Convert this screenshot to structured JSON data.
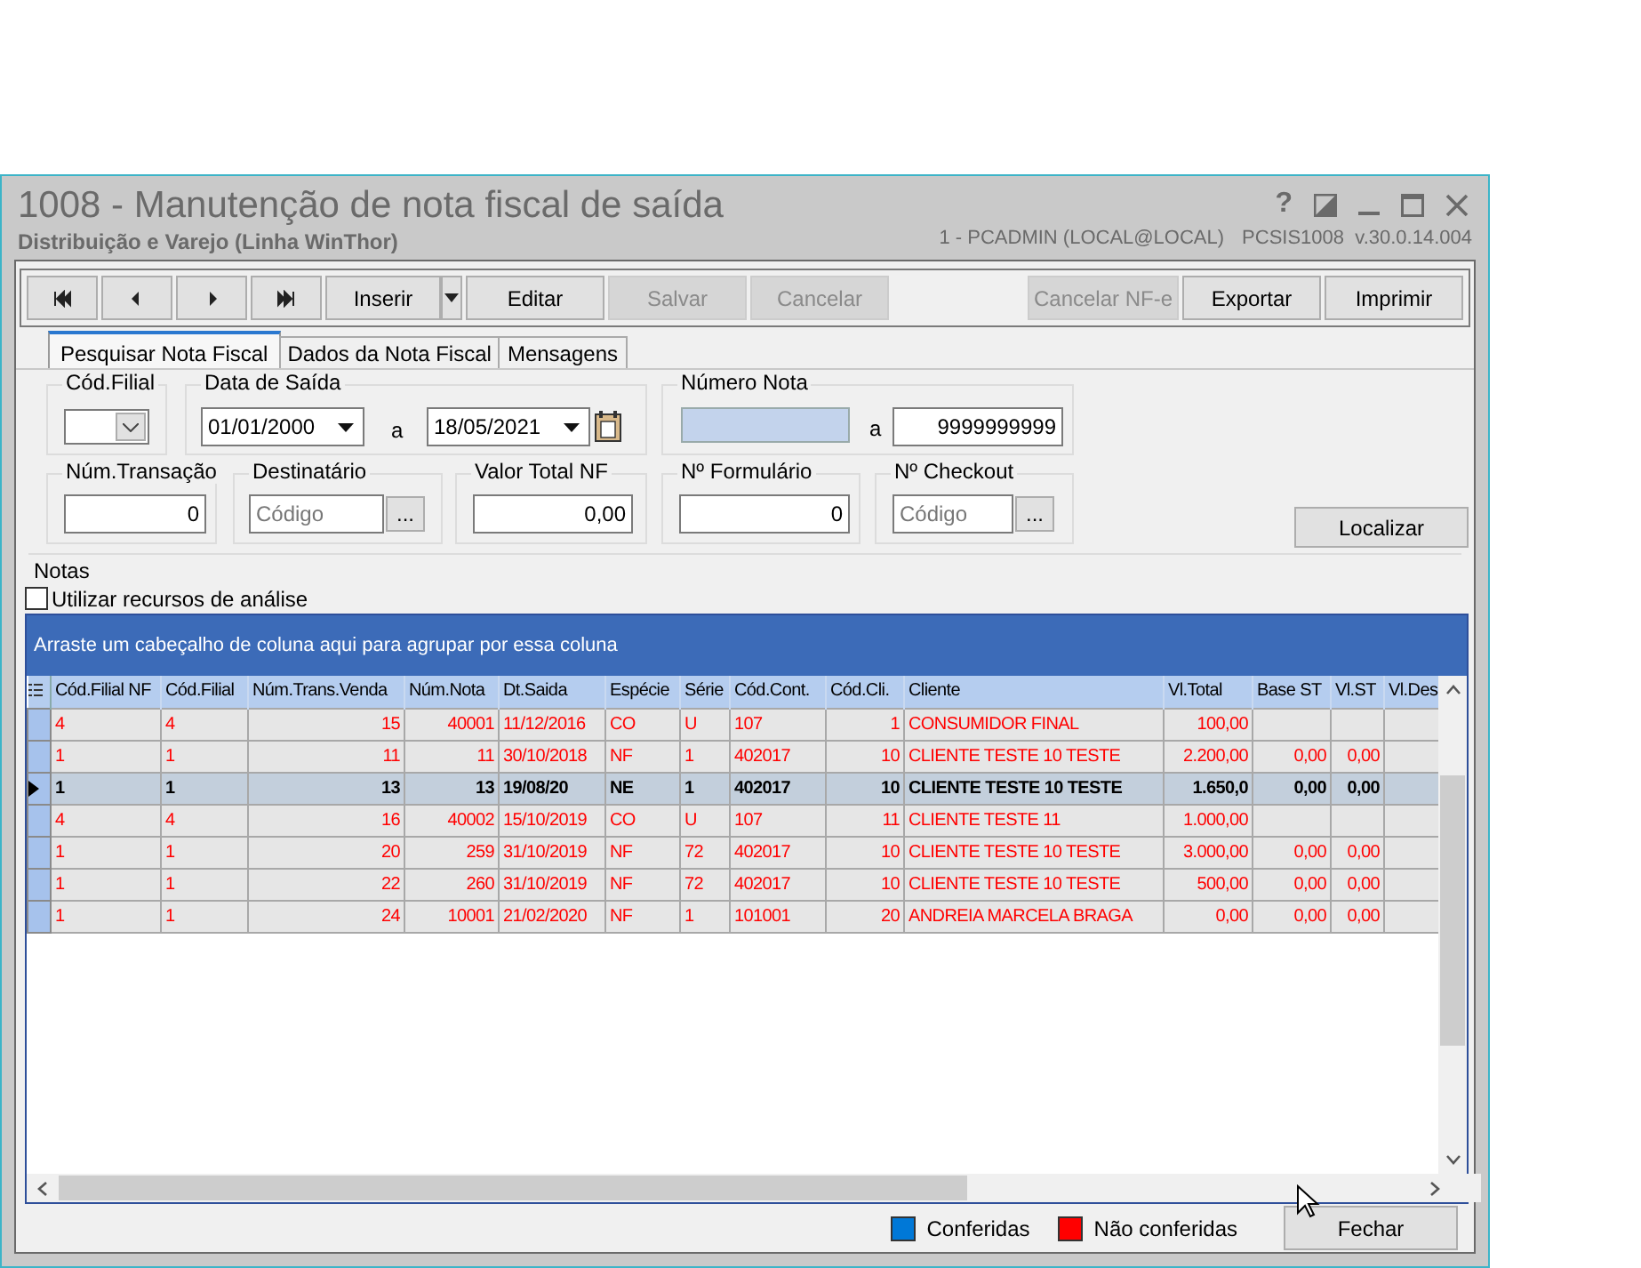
{
  "window": {
    "title": "1008 - Manutenção de nota fiscal de saída",
    "subtitle": "Distribuição e Varejo (Linha WinThor)",
    "user_info": "1 - PCADMIN (LOCAL@LOCAL)",
    "version": "PCSIS1008  v.30.0.14.004",
    "help": "?"
  },
  "toolbar": [
    {
      "kind": "first",
      "disabled": false
    },
    {
      "kind": "prev",
      "disabled": false
    },
    {
      "kind": "next",
      "disabled": false
    },
    {
      "kind": "last",
      "disabled": false
    },
    {
      "kind": "text",
      "label": "Inserir",
      "disabled": false
    },
    {
      "kind": "menu",
      "disabled": false
    },
    {
      "kind": "text",
      "label": "Editar",
      "disabled": false
    },
    {
      "kind": "text",
      "label": "Salvar",
      "disabled": true
    },
    {
      "kind": "text",
      "label": "Cancelar",
      "disabled": true
    },
    {
      "kind": "spacer"
    },
    {
      "kind": "text",
      "label": "Cancelar NF-e",
      "disabled": true
    },
    {
      "kind": "text",
      "label": "Exportar",
      "disabled": false
    },
    {
      "kind": "text",
      "label": "Imprimir",
      "disabled": false
    }
  ],
  "tabs": [
    {
      "label": "Pesquisar Nota Fiscal",
      "selected": true
    },
    {
      "label": "Dados da Nota Fiscal",
      "selected": false
    },
    {
      "label": "Mensagens",
      "selected": false
    }
  ],
  "filters": {
    "cod_filial": {
      "label": "Cód.Filial"
    },
    "data_saida": {
      "label": "Data de Saída",
      "from": "01/01/2000",
      "separator": "a",
      "to": "18/05/2021"
    },
    "numero_nota": {
      "label": "Número Nota",
      "separator": "a",
      "to": "9999999999"
    },
    "num_transacao": {
      "label": "Núm.Transação",
      "value": "0"
    },
    "destinatario": {
      "label": "Destinatário",
      "placeholder": "Código",
      "button": "..."
    },
    "valor_total": {
      "label": "Valor Total NF",
      "value": "0,00"
    },
    "num_formulario": {
      "label": "Nº Formulário",
      "value": "0"
    },
    "num_checkout": {
      "label": "Nº Checkout",
      "placeholder": "Código",
      "button": "..."
    },
    "search_button": "Localizar"
  },
  "notas": {
    "label": "Notas",
    "analysis_checkbox": {
      "label": "Utilizar recursos de análise",
      "checked": false
    },
    "group_hint": "Arraste um cabeçalho de coluna aqui para agrupar por essa coluna",
    "columns": [
      "Cód.Filial NF",
      "Cód.Filial",
      "Núm.Trans.Venda",
      "Núm.Nota",
      "Dt.Saida",
      "Espécie",
      "Série",
      "Cód.Cont.",
      "Cód.Cli.",
      "Cliente",
      "Vl.Total",
      "Base ST",
      "Vl.ST",
      "Vl.Des"
    ],
    "rows": [
      {
        "selected": false,
        "conferida": false,
        "cells": [
          "4",
          "4",
          "15",
          "40001",
          "11/12/2016",
          "CO",
          "U",
          "107",
          "1",
          "CONSUMIDOR FINAL",
          "100,00",
          null,
          null,
          null
        ]
      },
      {
        "selected": false,
        "conferida": false,
        "cells": [
          "1",
          "1",
          "11",
          "11",
          "30/10/2018",
          "NF",
          "1",
          "402017",
          "10",
          "CLIENTE TESTE 10 TESTE",
          "2.200,00",
          "0,00",
          "0,00",
          null
        ]
      },
      {
        "selected": true,
        "conferida": false,
        "cells": [
          "1",
          "1",
          "13",
          "13",
          "19/08/20",
          "NE",
          "1",
          "402017",
          "10",
          "CLIENTE TESTE 10 TESTE",
          "1.650,0",
          "0,00",
          "0,00",
          null
        ]
      },
      {
        "selected": false,
        "conferida": false,
        "cells": [
          "4",
          "4",
          "16",
          "40002",
          "15/10/2019",
          "CO",
          "U",
          "107",
          "11",
          "CLIENTE TESTE 11",
          "1.000,00",
          null,
          null,
          null
        ]
      },
      {
        "selected": false,
        "conferida": false,
        "cells": [
          "1",
          "1",
          "20",
          "259",
          "31/10/2019",
          "NF",
          "72",
          "402017",
          "10",
          "CLIENTE TESTE 10 TESTE",
          "3.000,00",
          "0,00",
          "0,00",
          null
        ]
      },
      {
        "selected": false,
        "conferida": false,
        "cells": [
          "1",
          "1",
          "22",
          "260",
          "31/10/2019",
          "NF",
          "72",
          "402017",
          "10",
          "CLIENTE TESTE 10 TESTE",
          "500,00",
          "0,00",
          "0,00",
          null
        ]
      },
      {
        "selected": false,
        "conferida": false,
        "cells": [
          "1",
          "1",
          "24",
          "10001",
          "21/02/2020",
          "NF",
          "1",
          "101001",
          "20",
          "ANDREIA MARCELA BRAGA",
          "0,00",
          "0,00",
          "0,00",
          null
        ]
      }
    ]
  },
  "legend": [
    {
      "label": "Conferidas",
      "color": "#0078d7"
    },
    {
      "label": "Não conferidas",
      "color": "#ff0000"
    }
  ],
  "close_button": "Fechar"
}
